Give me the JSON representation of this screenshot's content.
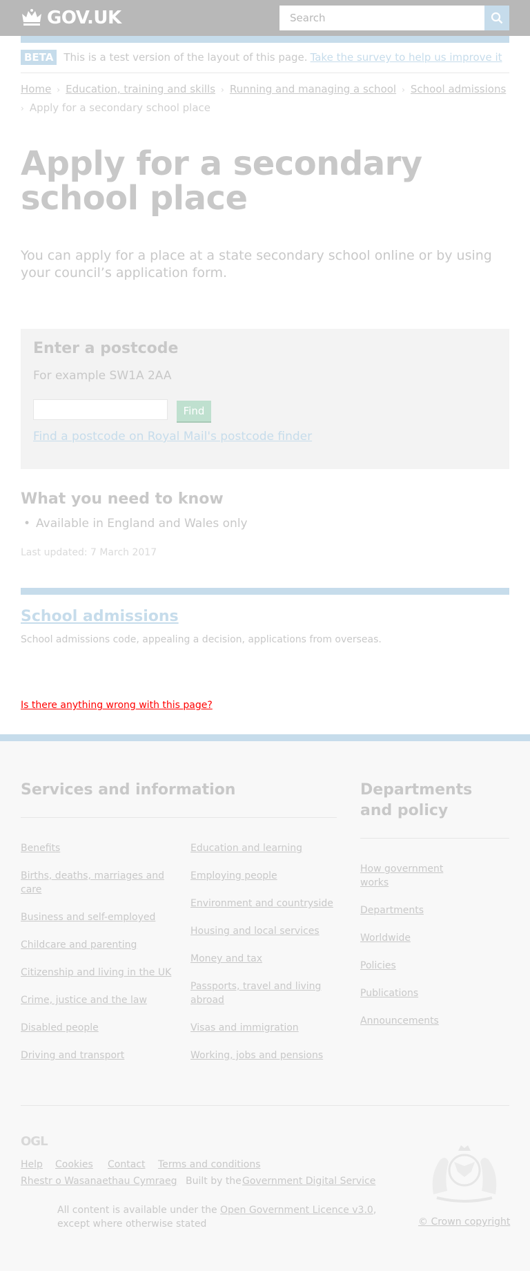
{
  "header": {
    "logo_text": "GOV.UK",
    "search_placeholder": "Search",
    "search_icon": "search-icon"
  },
  "beta": {
    "tag": "BETA",
    "text": "This is a test version of the layout of this page.",
    "link": "Take the survey to help us improve it"
  },
  "breadcrumbs": {
    "items": [
      "Home",
      "Education, training and skills",
      "Running and managing a school",
      "School admissions"
    ],
    "current": "Apply for a secondary school place"
  },
  "main": {
    "title": "Apply for a secondary school place",
    "lede": "You can apply for a place at a state secondary school online or by using your council’s application form.",
    "postcode": {
      "heading": "Enter a postcode",
      "hint": "For example SW1A 2AA",
      "input_value": "",
      "button": "Find",
      "link": "Find a postcode on Royal Mail's postcode finder"
    },
    "need_to_know": {
      "heading": "What you need to know",
      "items": [
        "Available in England and Wales only"
      ]
    },
    "updated": "Last updated: 7 March 2017"
  },
  "related": {
    "link": "School admissions",
    "description": "School admissions code, appealing a decision, applications from overseas."
  },
  "feedback": {
    "link": "Is there anything wrong with this page?"
  },
  "footer": {
    "services_heading": "Services and information",
    "services_col1": [
      "Benefits",
      "Births, deaths, marriages and care",
      "Business and self-employed",
      "Childcare and parenting",
      "Citizenship and living in the UK",
      "Crime, justice and the law",
      "Disabled people",
      "Driving and transport"
    ],
    "services_col2": [
      "Education and learning",
      "Employing people",
      "Environment and countryside",
      "Housing and local services",
      "Money and tax",
      "Passports, travel and living abroad",
      "Visas and immigration",
      "Working, jobs and pensions"
    ],
    "departments_heading": "Departments and policy",
    "departments": [
      "How government works",
      "Departments",
      "Worldwide",
      "Policies",
      "Publications",
      "Announcements"
    ],
    "support_links": [
      "Help",
      "Cookies",
      "Contact",
      "Terms and conditions"
    ],
    "welsh_link": "Rhestr o Wasanaethau Cymraeg",
    "built_by_text": "Built by the",
    "built_by_link": "Government Digital Service",
    "ogl": "OGL",
    "licence_text_1": "All content is available under the",
    "licence_link": "Open Government Licence v3.0",
    "licence_text_2": ", except where otherwise stated",
    "copyright": "© Crown copyright"
  }
}
